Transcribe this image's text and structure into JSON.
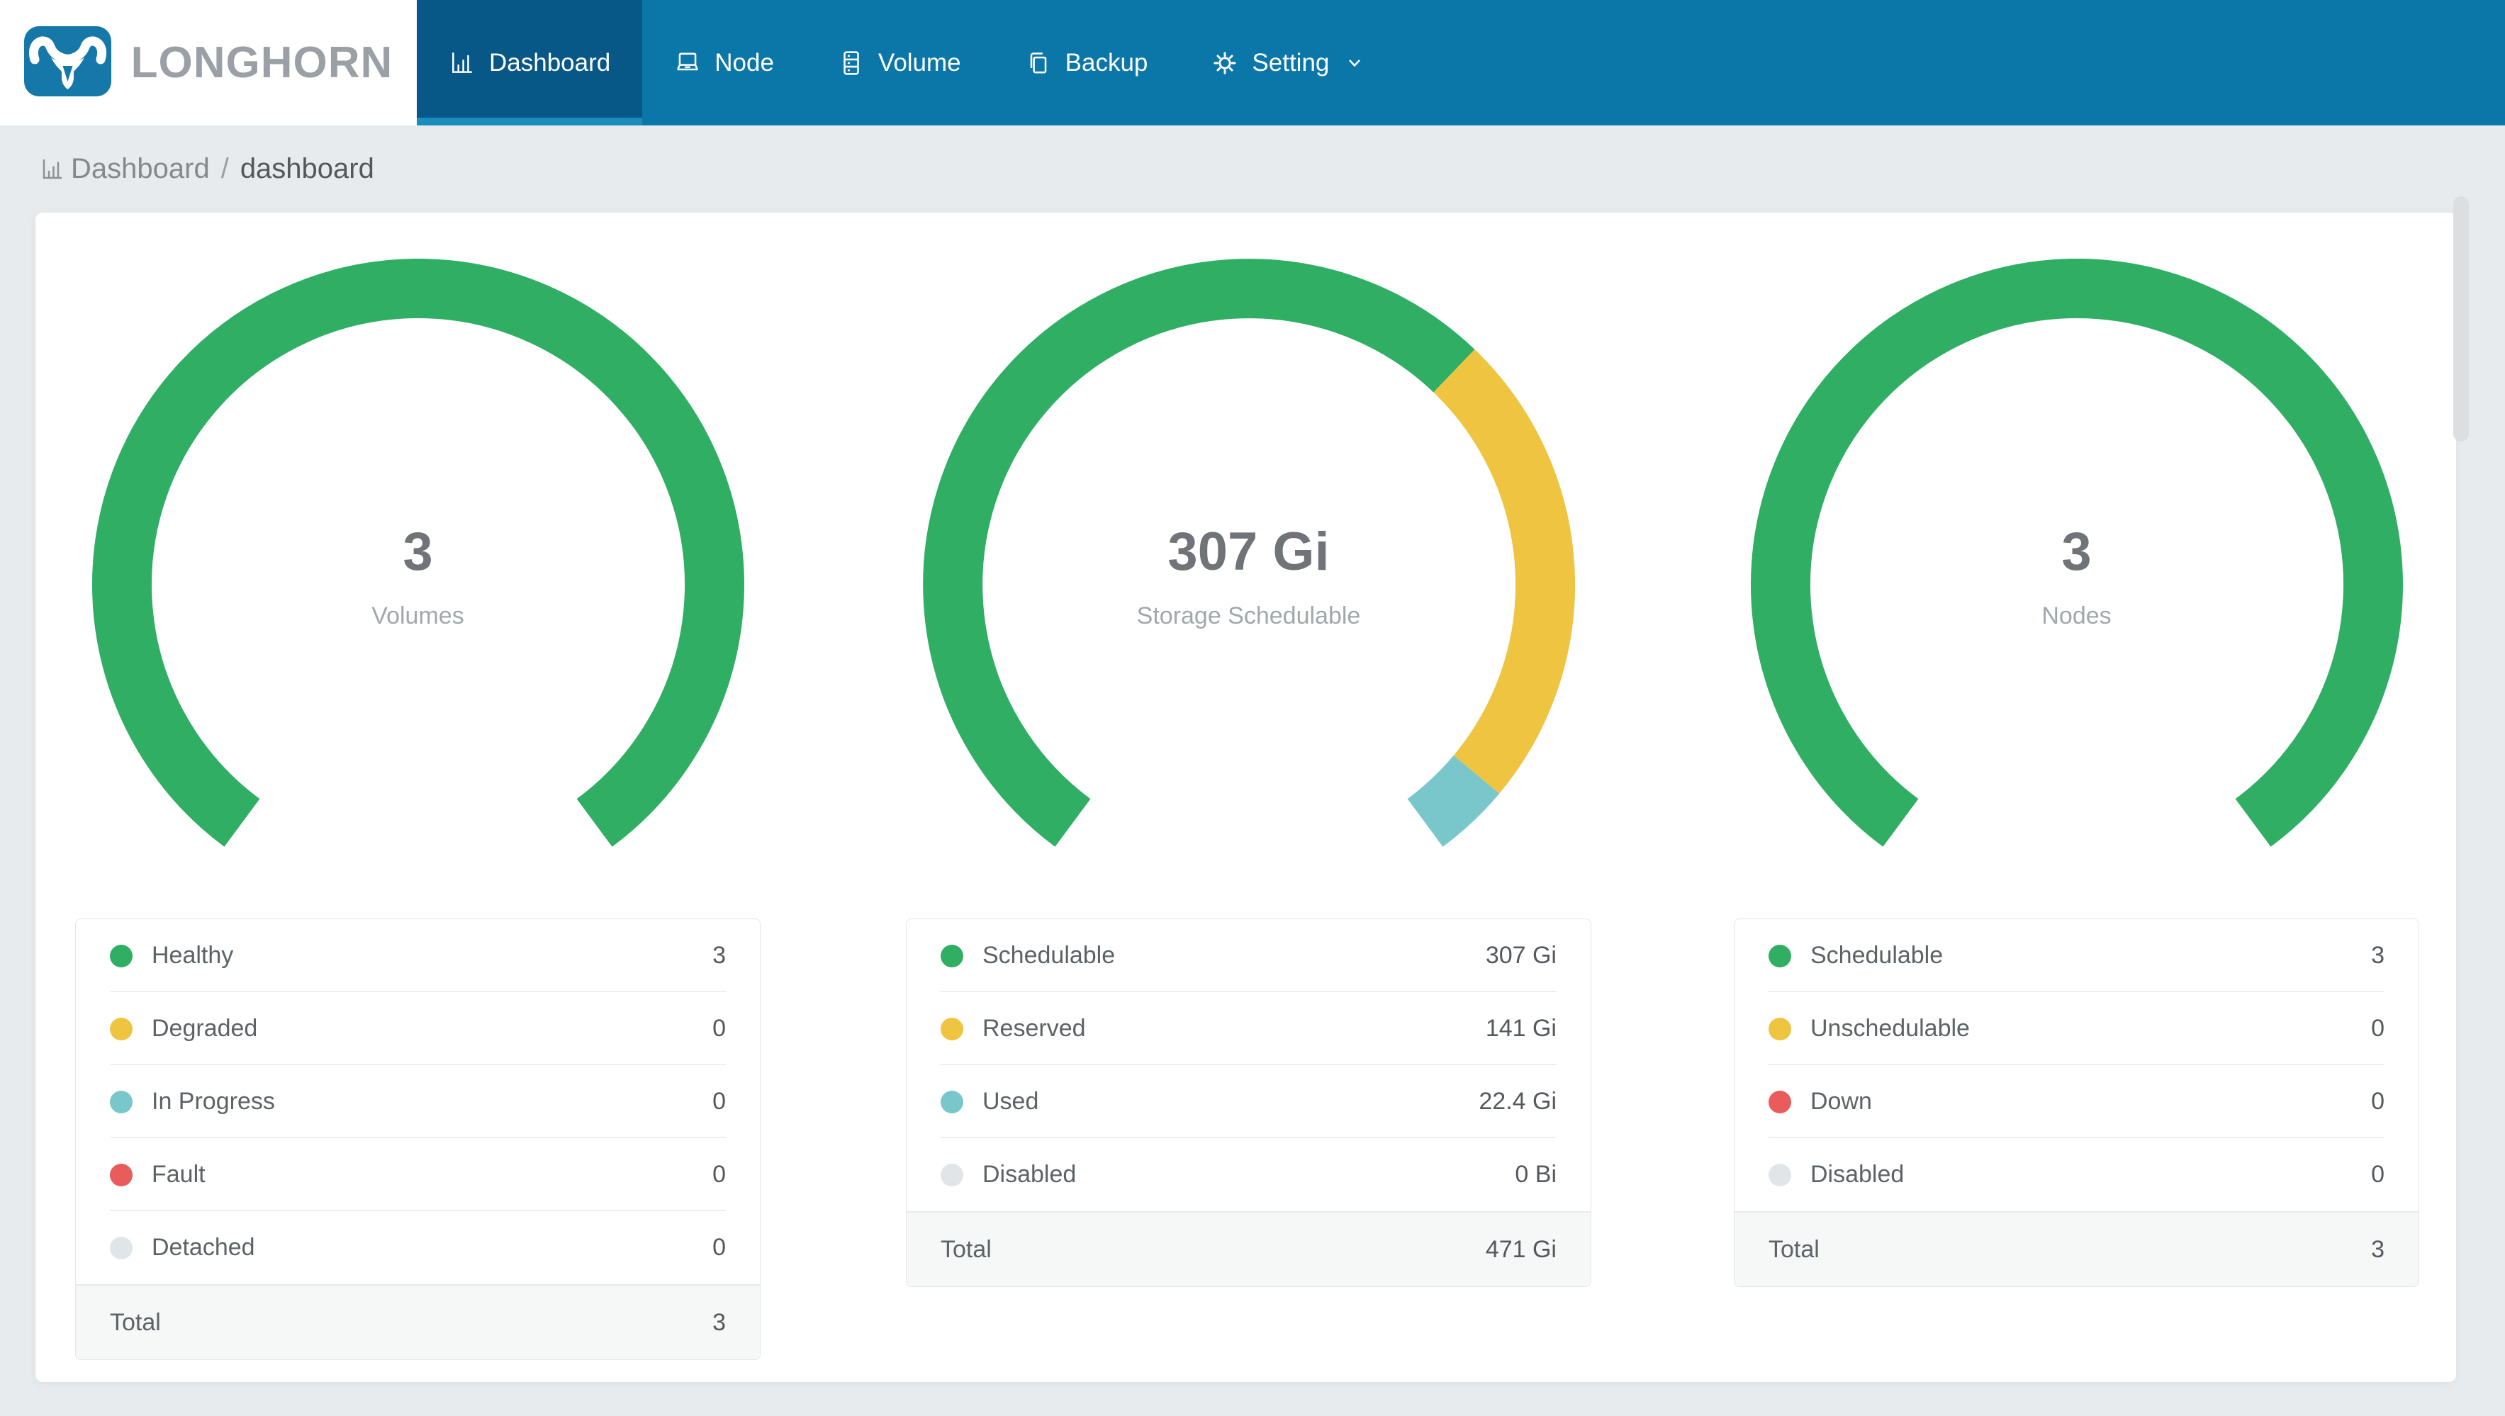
{
  "navbar": {
    "logo": {
      "text": "LONGHORN"
    },
    "items": [
      {
        "label": "Dashboard",
        "icon": "bar-chart-icon",
        "active": true,
        "dropdown": false
      },
      {
        "label": "Node",
        "icon": "laptop-icon",
        "active": false,
        "dropdown": false
      },
      {
        "label": "Volume",
        "icon": "server-icon",
        "active": false,
        "dropdown": false
      },
      {
        "label": "Backup",
        "icon": "copy-icon",
        "active": false,
        "dropdown": false
      },
      {
        "label": "Setting",
        "icon": "gear-icon",
        "active": false,
        "dropdown": true
      }
    ]
  },
  "breadcrumb": {
    "root": "Dashboard",
    "separator": "/",
    "current": "dashboard"
  },
  "colors": {
    "navbar_blue": "#0b76a8",
    "active_tab": "#075787",
    "active_indicator": "#1b8cbe",
    "brand_blue": "#1578a8",
    "page_bg": "#e8ebed",
    "healthy_green": "#2fae64",
    "warning_yellow": "#efc441",
    "progress_teal": "#7ac7cb",
    "fault_red": "#ea5c5c",
    "disabled_gray": "#e2e5e7"
  },
  "chart_data": [
    {
      "id": "volumes",
      "type": "donut-gauge",
      "center_value": "3",
      "center_label": "Volumes",
      "segments": [
        {
          "label": "Healthy",
          "value": 3,
          "display": "3",
          "color": "#2fae64"
        },
        {
          "label": "Degraded",
          "value": 0,
          "display": "0",
          "color": "#efc441"
        },
        {
          "label": "In Progress",
          "value": 0,
          "display": "0",
          "color": "#7ac7cb"
        },
        {
          "label": "Fault",
          "value": 0,
          "display": "0",
          "color": "#ea5c5c"
        },
        {
          "label": "Detached",
          "value": 0,
          "display": "0",
          "color": "#e2e5e7"
        }
      ],
      "total": {
        "label": "Total",
        "display": "3"
      }
    },
    {
      "id": "storage",
      "type": "donut-gauge",
      "center_value": "307 Gi",
      "center_label": "Storage Schedulable",
      "segments": [
        {
          "label": "Schedulable",
          "value": 307,
          "display": "307 Gi",
          "color": "#2fae64"
        },
        {
          "label": "Reserved",
          "value": 141,
          "display": "141 Gi",
          "color": "#efc441"
        },
        {
          "label": "Used",
          "value": 22.4,
          "display": "22.4 Gi",
          "color": "#7ac7cb"
        },
        {
          "label": "Disabled",
          "value": 0,
          "display": "0 Bi",
          "color": "#e2e5e7"
        }
      ],
      "total": {
        "label": "Total",
        "display": "471 Gi"
      }
    },
    {
      "id": "nodes",
      "type": "donut-gauge",
      "center_value": "3",
      "center_label": "Nodes",
      "segments": [
        {
          "label": "Schedulable",
          "value": 3,
          "display": "3",
          "color": "#2fae64"
        },
        {
          "label": "Unschedulable",
          "value": 0,
          "display": "0",
          "color": "#efc441"
        },
        {
          "label": "Down",
          "value": 0,
          "display": "0",
          "color": "#ea5c5c"
        },
        {
          "label": "Disabled",
          "value": 0,
          "display": "0",
          "color": "#e2e5e7"
        }
      ],
      "total": {
        "label": "Total",
        "display": "3"
      }
    }
  ]
}
